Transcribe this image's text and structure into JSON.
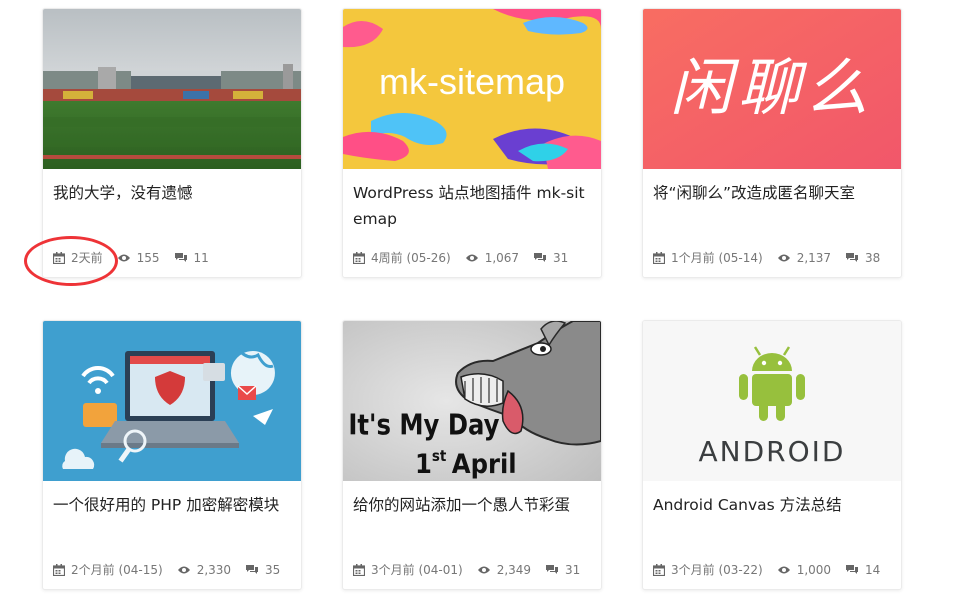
{
  "posts": [
    {
      "title": "我的大学，没有遗憾",
      "date": "2天前",
      "views": "155",
      "comments": "11",
      "thumb": "stadium"
    },
    {
      "title": "WordPress 站点地图插件 mk-sitemap",
      "date": "4周前 (05-26)",
      "views": "1,067",
      "comments": "31",
      "thumb": "mk-sitemap",
      "thumb_text": "mk-sitemap"
    },
    {
      "title": "将“闲聊么”改造成匿名聊天室",
      "date": "1个月前 (05-14)",
      "views": "2,137",
      "comments": "38",
      "thumb": "chat",
      "thumb_text": "闲聊么"
    },
    {
      "title": "一个很好用的 PHP 加密解密模块",
      "date": "2个月前 (04-15)",
      "views": "2,330",
      "comments": "35",
      "thumb": "security"
    },
    {
      "title": "给你的网站添加一个愚人节彩蛋",
      "date": "3个月前 (04-01)",
      "views": "2,349",
      "comments": "31",
      "thumb": "april-fools",
      "thumb_text_1": "It's My Day",
      "thumb_text_2": "1",
      "thumb_text_3": "st",
      "thumb_text_4": "April"
    },
    {
      "title": "Android Canvas 方法总结",
      "date": "3个月前 (03-22)",
      "views": "1,000",
      "comments": "14",
      "thumb": "android",
      "thumb_text": "ANDROID"
    }
  ],
  "colors": {
    "accent_circle": "#ee3337",
    "meta_text": "#777777",
    "title_text": "#222222"
  },
  "icons": {
    "date": "calendar-icon",
    "views": "eye-icon",
    "comments": "comments-icon"
  }
}
